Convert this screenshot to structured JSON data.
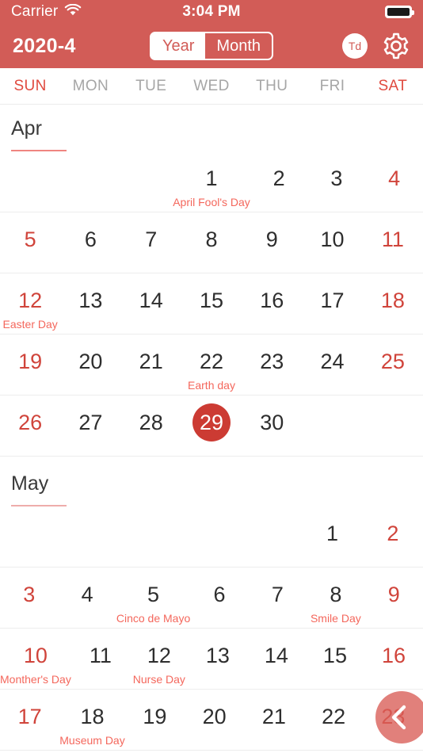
{
  "status_bar": {
    "carrier": "Carrier",
    "wifi_icon": "wifi-icon",
    "time": "3:04 PM",
    "battery_icon": "battery-full-icon"
  },
  "nav": {
    "title": "2020-4",
    "segmented": {
      "year_label": "Year",
      "month_label": "Month",
      "selected": "Month"
    },
    "today_button": "Td",
    "settings_icon": "gear-icon"
  },
  "weekdays": [
    {
      "label": "SUN",
      "weekend": true
    },
    {
      "label": "MON",
      "weekend": false
    },
    {
      "label": "TUE",
      "weekend": false
    },
    {
      "label": "WED",
      "weekend": false
    },
    {
      "label": "THU",
      "weekend": false
    },
    {
      "label": "FRI",
      "weekend": false
    },
    {
      "label": "SAT",
      "weekend": true
    }
  ],
  "colors": {
    "header_background": "#d25c57",
    "accent_red": "#d0443b",
    "selected_day": "#cc3b33",
    "event_text": "#f4675c",
    "weekday_gray": "#a6a6a6",
    "day_text": "#2e2e2e",
    "separator": "#ededed",
    "month_underline": "#eeadab"
  },
  "months": [
    {
      "name": "Apr",
      "underline_strong": true,
      "weeks": [
        [
          {
            "day": ""
          },
          {
            "day": ""
          },
          {
            "day": ""
          },
          {
            "day": "1",
            "event": "April Fool's Day"
          },
          {
            "day": "2"
          },
          {
            "day": "3"
          },
          {
            "day": "4",
            "weekend": true
          }
        ],
        [
          {
            "day": "5",
            "weekend": true
          },
          {
            "day": "6"
          },
          {
            "day": "7"
          },
          {
            "day": "8"
          },
          {
            "day": "9"
          },
          {
            "day": "10"
          },
          {
            "day": "11",
            "weekend": true
          }
        ],
        [
          {
            "day": "12",
            "weekend": true,
            "event": "Easter Day"
          },
          {
            "day": "13"
          },
          {
            "day": "14"
          },
          {
            "day": "15"
          },
          {
            "day": "16"
          },
          {
            "day": "17"
          },
          {
            "day": "18",
            "weekend": true
          }
        ],
        [
          {
            "day": "19",
            "weekend": true
          },
          {
            "day": "20"
          },
          {
            "day": "21"
          },
          {
            "day": "22",
            "event": "Earth day"
          },
          {
            "day": "23"
          },
          {
            "day": "24"
          },
          {
            "day": "25",
            "weekend": true
          }
        ],
        [
          {
            "day": "26",
            "weekend": true
          },
          {
            "day": "27"
          },
          {
            "day": "28"
          },
          {
            "day": "29",
            "selected": true
          },
          {
            "day": "30"
          },
          {
            "day": ""
          },
          {
            "day": ""
          }
        ]
      ]
    },
    {
      "name": "May",
      "underline_strong": false,
      "weeks": [
        [
          {
            "day": ""
          },
          {
            "day": ""
          },
          {
            "day": ""
          },
          {
            "day": ""
          },
          {
            "day": ""
          },
          {
            "day": "1"
          },
          {
            "day": "2",
            "weekend": true
          }
        ],
        [
          {
            "day": "3",
            "weekend": true
          },
          {
            "day": "4"
          },
          {
            "day": "5",
            "event": "Cinco de Mayo"
          },
          {
            "day": "6"
          },
          {
            "day": "7"
          },
          {
            "day": "8",
            "event": "Smile Day"
          },
          {
            "day": "9",
            "weekend": true
          }
        ],
        [
          {
            "day": "10",
            "weekend": true,
            "event": "Monther's Day"
          },
          {
            "day": "11"
          },
          {
            "day": "12",
            "event": "Nurse Day"
          },
          {
            "day": "13"
          },
          {
            "day": "14"
          },
          {
            "day": "15"
          },
          {
            "day": "16",
            "weekend": true
          }
        ],
        [
          {
            "day": "17",
            "weekend": true
          },
          {
            "day": "18",
            "event": "Museum Day"
          },
          {
            "day": "19"
          },
          {
            "day": "20"
          },
          {
            "day": "21"
          },
          {
            "day": "22"
          },
          {
            "day": "23",
            "weekend": true
          }
        ]
      ]
    }
  ],
  "fab": {
    "icon": "chevron-left-icon"
  }
}
